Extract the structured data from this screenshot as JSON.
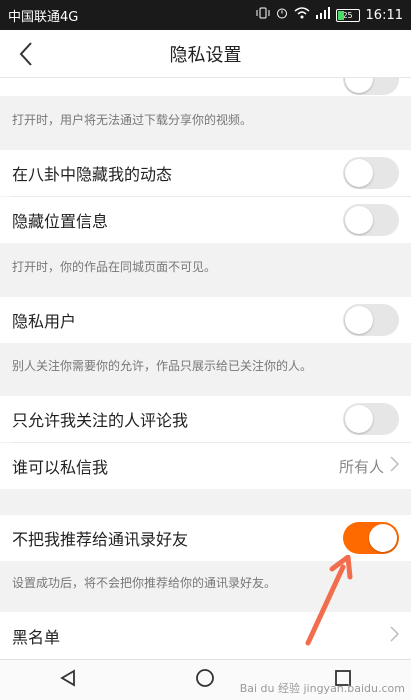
{
  "status_bar": {
    "carrier": "中国联通4G",
    "battery": "25",
    "time": "16:11"
  },
  "header": {
    "title": "隐私设置",
    "back_icon": "chevron-left-icon"
  },
  "rows": {
    "top_note": "打开时，用户将无法通过下载分享你的视频。",
    "hide_feed": {
      "label": "在八卦中隐藏我的动态",
      "on": false
    },
    "hide_location": {
      "label": "隐藏位置信息",
      "on": false
    },
    "location_note": "打开时，你的作品在同城页面不可见。",
    "private_user": {
      "label": "隐私用户",
      "on": false
    },
    "private_note": "别人关注你需要你的允许，作品只展示给已关注你的人。",
    "comment_only_followed": {
      "label": "只允许我关注的人评论我",
      "on": false
    },
    "who_can_message": {
      "label": "谁可以私信我",
      "value": "所有人"
    },
    "no_recommend_contacts": {
      "label": "不把我推荐给通讯录好友",
      "on": true
    },
    "recommend_note": "设置成功后，将不会把你推荐给你的通讯录好友。",
    "blacklist": {
      "label": "黑名单"
    }
  },
  "watermark": "Bai du 经验 jingyan.baidu.com",
  "colors": {
    "accent": "#ff6a00",
    "annotation_arrow": "#f26d4d"
  }
}
